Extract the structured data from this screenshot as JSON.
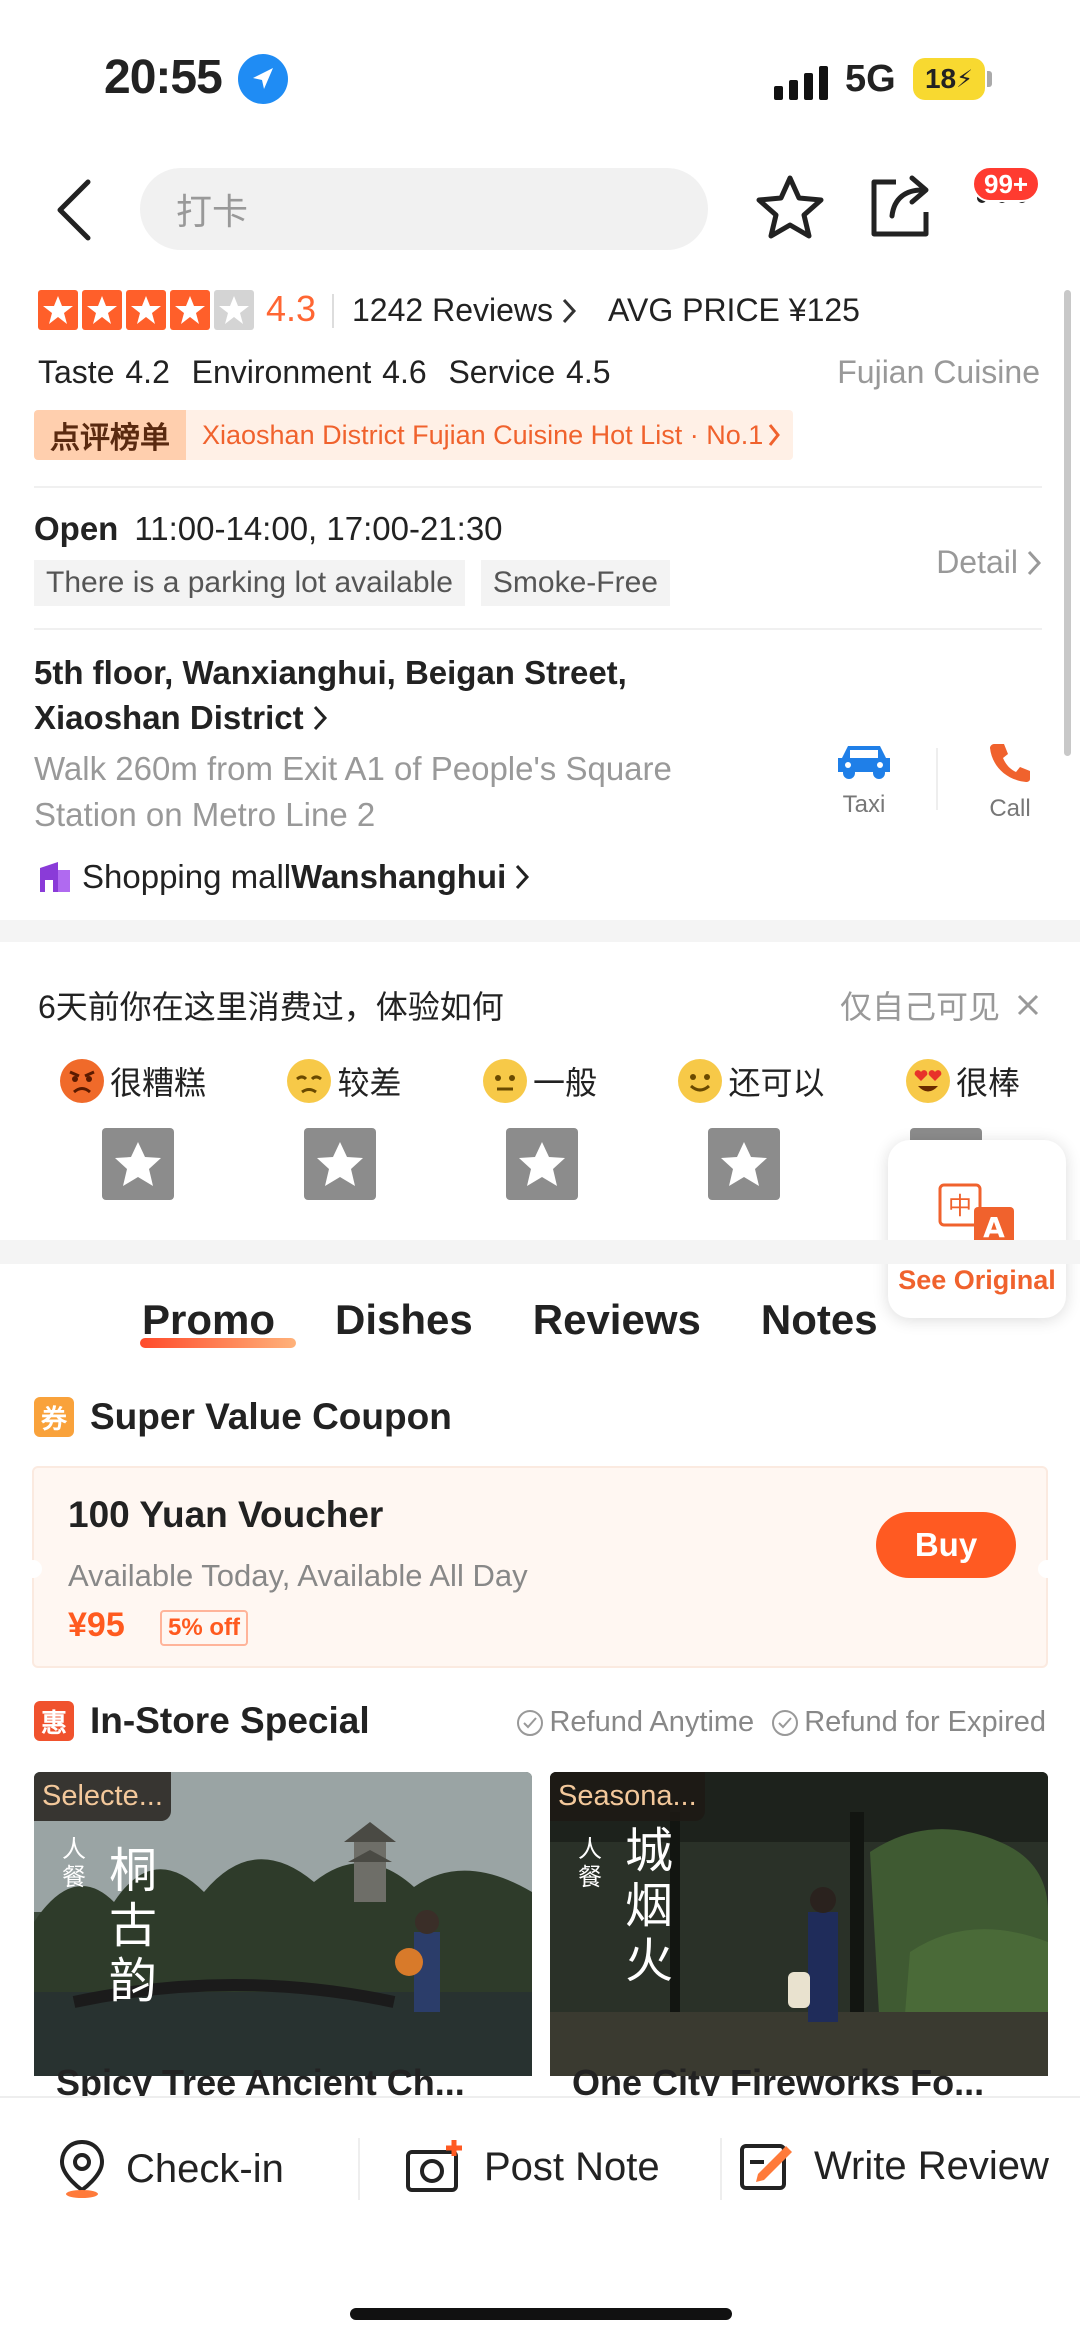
{
  "status": {
    "time": "20:55",
    "network": "5G",
    "battery": "18"
  },
  "nav": {
    "search_placeholder": "打卡",
    "badge": "99+"
  },
  "rating": {
    "score": "4.3",
    "stars": 4.5,
    "reviews": "1242 Reviews",
    "avg_price": "AVG PRICE ¥125",
    "sub_scores": "Taste 4.2  Environment 4.6  Service 4.5",
    "cuisine": "Fujian Cuisine"
  },
  "hotlist": {
    "brand": "点评榜单",
    "text": "Xiaoshan District Fujian Cuisine Hot List · No.1"
  },
  "hours": {
    "label": "Open",
    "value": "11:00-14:00, 17:00-21:30",
    "detail": "Detail"
  },
  "tags": [
    "There is a parking lot available",
    "Smoke-Free"
  ],
  "address": {
    "text": "5th floor, Wanxianghui, Beigan Street, Xiaoshan District",
    "walk": "Walk 260m from Exit A1 of People's Square Station on Metro Line 2",
    "taxi": "Taxi",
    "call": "Call",
    "mall_prefix": "Shopping mall",
    "mall_name": "Wanshanghui"
  },
  "feedback": {
    "question": "6天前你在这里消费过，体验如何",
    "visibility": "仅自己可见",
    "moods": [
      {
        "label": "很糟糕",
        "icon": "angry-face-icon",
        "color": "#f06a2a"
      },
      {
        "label": "较差",
        "icon": "disappointed-face-icon",
        "color": "#f7c948"
      },
      {
        "label": "一般",
        "icon": "neutral-face-icon",
        "color": "#f7c948"
      },
      {
        "label": "还可以",
        "icon": "smile-face-icon",
        "color": "#f7c948"
      },
      {
        "label": "很棒",
        "icon": "heart-eyes-face-icon",
        "color": "#f7c948"
      }
    ],
    "translate": "See Original"
  },
  "tabs": [
    "Promo",
    "Dishes",
    "Reviews",
    "Notes"
  ],
  "coupon_section": {
    "icon_text": "券",
    "title": "Super Value Coupon",
    "coupon": {
      "title": "100 Yuan Voucher",
      "availability": "Available Today, Available All Day",
      "price": "¥95",
      "discount": "5% off",
      "buy": "Buy"
    }
  },
  "instore": {
    "icon_text": "惠",
    "title": "In-Store Special",
    "refund1": "Refund Anytime",
    "refund2": "Refund for Expired",
    "cards": [
      {
        "label": "Selecte...",
        "title": "Spicy Tree Ancient Ch...",
        "poster_text_small": "人餐",
        "poster_text": "桐古韵"
      },
      {
        "label": "Seasona...",
        "title": "One City Fireworks Fo...",
        "poster_text_small": "人餐",
        "poster_text": "城烟火"
      }
    ]
  },
  "bottom": {
    "checkin": "Check-in",
    "post": "Post Note",
    "review": "Write Review"
  },
  "colors": {
    "accent": "#ff5a22",
    "star": "#ff5f2a"
  }
}
